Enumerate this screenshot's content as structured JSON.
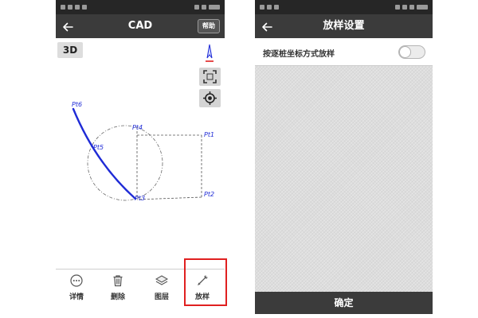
{
  "colors": {
    "status_bar": "#262626",
    "header": "#3b3b3b",
    "cad_line": "#1f2bd6",
    "cad_guide": "#555555",
    "highlight": "#e02020",
    "panel": "#dcdcdc"
  },
  "left_phone": {
    "header": {
      "back_icon": "back-arrow-icon",
      "title": "CAD",
      "help_label": "帮助"
    },
    "canvas": {
      "view_3d_label": "3D",
      "tools": [
        {
          "icon": "north-arrow-icon"
        },
        {
          "icon": "zoom-extents-icon"
        },
        {
          "icon": "locate-icon"
        }
      ],
      "points": {
        "pt1": "Pt1",
        "pt2": "Pt2",
        "pt3": "Pt3",
        "pt4": "Pt4",
        "pt5": "Pt5",
        "pt6": "Pt6"
      }
    },
    "toolbar": {
      "items": [
        {
          "label": "详情",
          "icon": "more-circle-icon"
        },
        {
          "label": "删除",
          "icon": "trash-icon"
        },
        {
          "label": "图层",
          "icon": "layers-icon"
        },
        {
          "label": "放样",
          "icon": "stakeout-icon",
          "highlighted": true
        }
      ]
    }
  },
  "right_phone": {
    "header": {
      "back_icon": "back-arrow-icon",
      "title": "放样设置"
    },
    "option": {
      "label": "按逐桩坐标方式放样",
      "toggle_on": false
    },
    "confirm_label": "确定"
  }
}
